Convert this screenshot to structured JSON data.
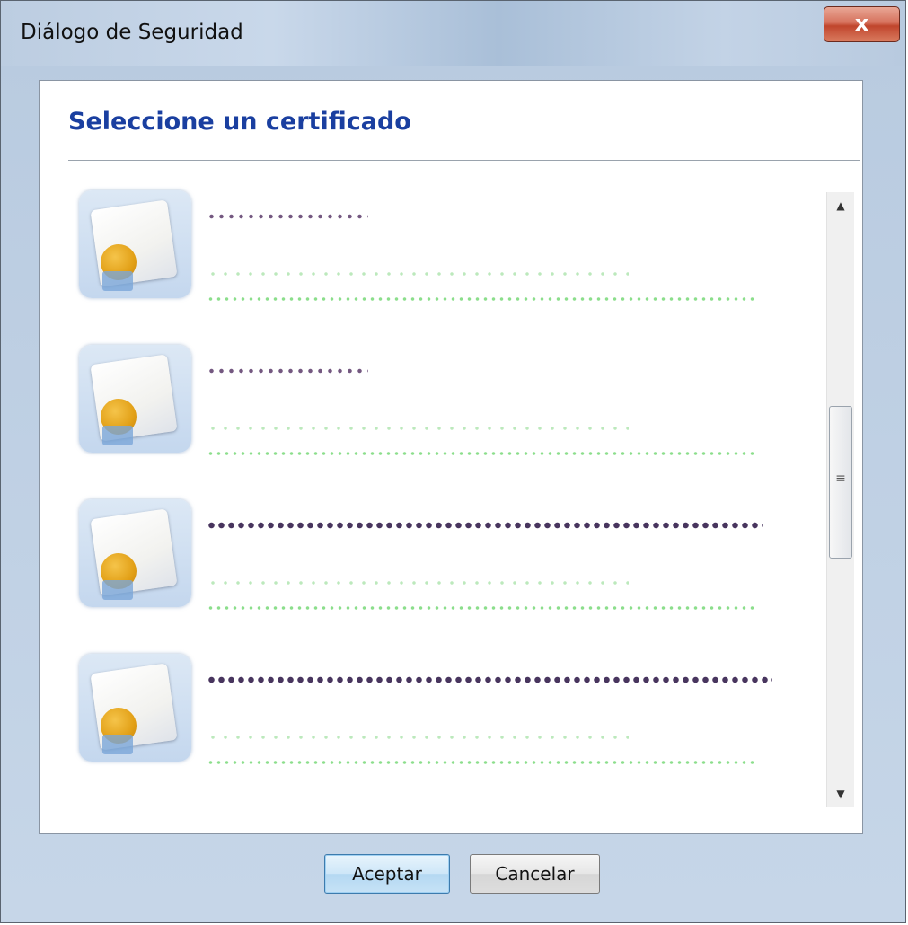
{
  "window": {
    "title": "Diálogo de Seguridad",
    "close_label": "x"
  },
  "dialog": {
    "heading": "Seleccione un certificado"
  },
  "certificates": [
    {
      "icon": "certificate-icon",
      "name": "",
      "issuer": "",
      "details": ""
    },
    {
      "icon": "certificate-icon",
      "name": "",
      "issuer": "",
      "details": ""
    },
    {
      "icon": "certificate-icon",
      "name": "",
      "issuer": "",
      "details": ""
    },
    {
      "icon": "certificate-icon",
      "name": "",
      "issuer": "",
      "details": ""
    }
  ],
  "scrollbar": {
    "up_glyph": "▲",
    "down_glyph": "▼",
    "grip_glyph": "≡"
  },
  "buttons": {
    "accept_label": "Aceptar",
    "cancel_label": "Cancelar"
  },
  "colors": {
    "heading": "#1a3fa0",
    "primary_button": "#cde6f8",
    "close_button": "#c0452c"
  }
}
